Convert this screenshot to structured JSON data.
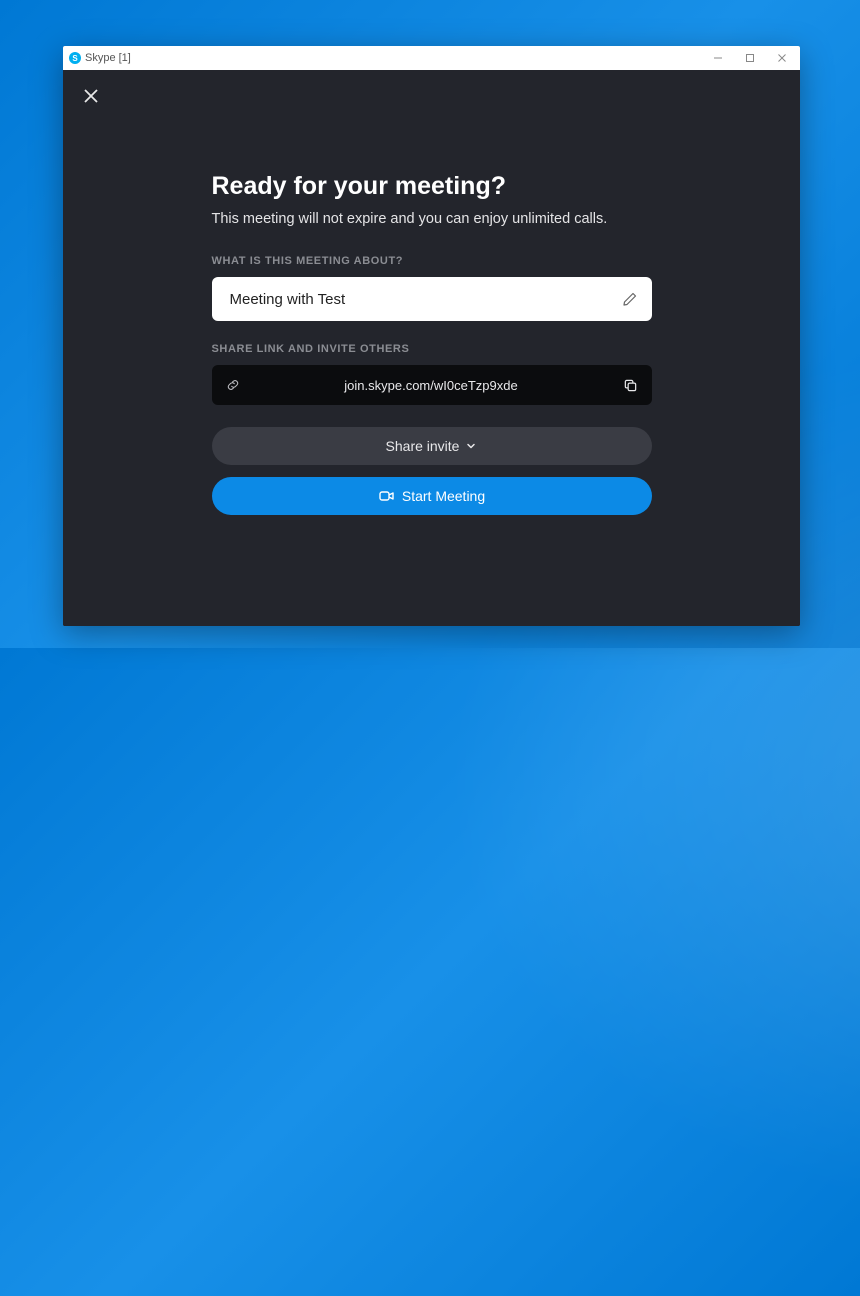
{
  "window": {
    "title": "Skype [1]"
  },
  "dialog": {
    "heading": "Ready for your meeting?",
    "subheading": "This meeting will not expire and you can enjoy unlimited calls.",
    "meeting_name_label": "WHAT IS THIS MEETING ABOUT?",
    "meeting_name_value": "Meeting with Test",
    "share_label": "SHARE LINK AND INVITE OTHERS",
    "share_link": "join.skype.com/wI0ceTzp9xde",
    "share_invite_button": "Share invite",
    "start_button": "Start Meeting"
  }
}
